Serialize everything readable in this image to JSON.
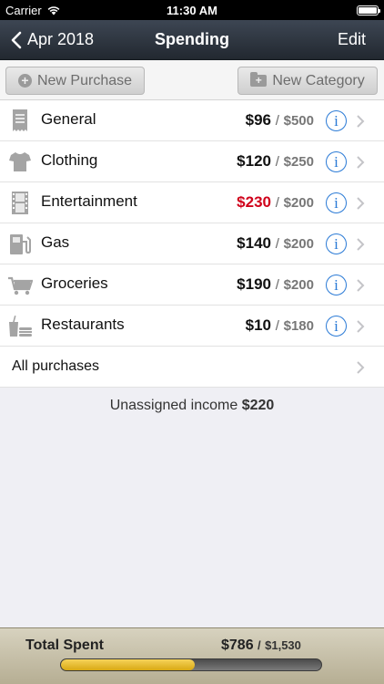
{
  "status": {
    "carrier": "Carrier",
    "time": "11:30 AM"
  },
  "nav": {
    "back_label": "Apr 2018",
    "title": "Spending",
    "edit_label": "Edit"
  },
  "toolbar": {
    "new_purchase_label": "New Purchase",
    "new_category_label": "New Category"
  },
  "categories": [
    {
      "name": "General",
      "spent": "$96",
      "budget": "$500",
      "over": false,
      "icon": "receipt-icon"
    },
    {
      "name": "Clothing",
      "spent": "$120",
      "budget": "$250",
      "over": false,
      "icon": "shirt-icon"
    },
    {
      "name": "Entertainment",
      "spent": "$230",
      "budget": "$200",
      "over": true,
      "icon": "film-icon"
    },
    {
      "name": "Gas",
      "spent": "$140",
      "budget": "$200",
      "over": false,
      "icon": "gas-pump-icon"
    },
    {
      "name": "Groceries",
      "spent": "$190",
      "budget": "$200",
      "over": false,
      "icon": "cart-icon"
    },
    {
      "name": "Restaurants",
      "spent": "$10",
      "budget": "$180",
      "over": false,
      "icon": "food-drink-icon"
    }
  ],
  "separator": "/",
  "all_purchases_label": "All purchases",
  "unassigned": {
    "label": "Unassigned income",
    "amount": "$220"
  },
  "footer": {
    "total_label": "Total Spent",
    "spent": "$786",
    "budget": "$1,530",
    "progress_fraction": 0.514
  },
  "colors": {
    "nav_dark": "#222830",
    "over_budget": "#d0021b",
    "info_blue": "#2a7ad6",
    "progress_gold": "#e3b320"
  }
}
